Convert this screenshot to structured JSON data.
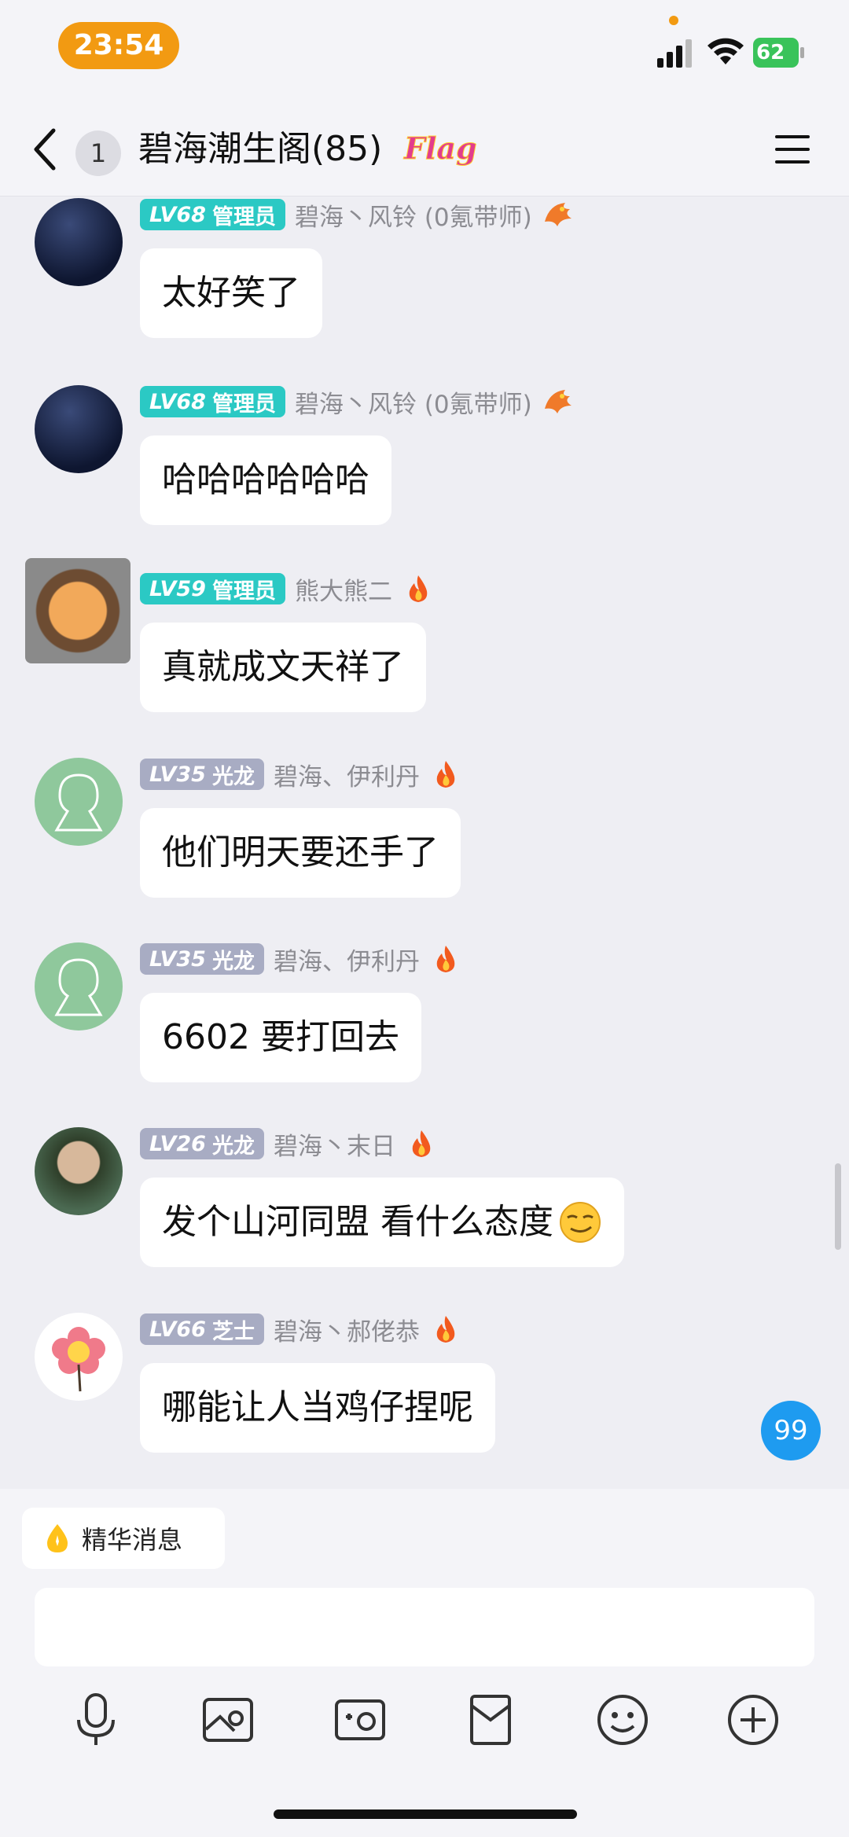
{
  "status_bar": {
    "time": "23:54",
    "battery": "62",
    "icons": [
      "cellular-icon",
      "wifi-icon",
      "battery-charging-icon"
    ]
  },
  "nav": {
    "unread_count": "1",
    "title": "碧海潮生阁(85)",
    "flag_label": "Flag",
    "icons": [
      "back-chevron-icon",
      "menu-icon"
    ]
  },
  "messages": [
    {
      "level": "LV68",
      "title": "管理员",
      "badge_color": "#2BC9C4",
      "sender": "碧海丶风铃 (0氪带师)",
      "flair_icon": "dragon-emblem-icon",
      "text": "太好笑了",
      "avatar_icon": "night-silhouette-avatar"
    },
    {
      "level": "LV68",
      "title": "管理员",
      "badge_color": "#2BC9C4",
      "sender": "碧海丶风铃 (0氪带师)",
      "flair_icon": "dragon-emblem-icon",
      "text": "哈哈哈哈哈哈",
      "avatar_icon": "night-silhouette-avatar"
    },
    {
      "level": "LV59",
      "title": "管理员",
      "badge_color": "#2BC9C4",
      "sender": "熊大熊二",
      "flair_icon": "fire-icon",
      "text": "真就成文天祥了",
      "avatar_icon": "cat-gear-frame-avatar"
    },
    {
      "level": "LV35",
      "title": "光龙",
      "badge_color": "#A8ACC3",
      "sender": "碧海、伊利丹",
      "flair_icon": "fire-icon",
      "text": "他们明天要还手了",
      "avatar_icon": "default-ghost-avatar"
    },
    {
      "level": "LV35",
      "title": "光龙",
      "badge_color": "#A8ACC3",
      "sender": "碧海、伊利丹",
      "flair_icon": "fire-icon",
      "text": "6602 要打回去",
      "avatar_icon": "default-ghost-avatar"
    },
    {
      "level": "LV26",
      "title": "光龙",
      "badge_color": "#A8ACC3",
      "sender": "碧海丶末日",
      "flair_icon": "fire-icon",
      "text": "发个山河同盟 看什么态度",
      "trailing_emoji": "smirk-emoji-icon",
      "avatar_icon": "boy-photo-avatar"
    },
    {
      "level": "LV66",
      "title": "芝士",
      "badge_color": "#A8ACC3",
      "sender": "碧海丶郝佬恭",
      "flair_icon": "fire-icon",
      "text": "哪能让人当鸡仔捏呢",
      "avatar_icon": "flower-avatar"
    }
  ],
  "new_message_count": "99",
  "essence": {
    "label": "精华消息",
    "icon": "essence-drop-icon"
  },
  "input": {
    "placeholder": ""
  },
  "toolbar": {
    "items": [
      "microphone-icon",
      "image-icon",
      "camera-icon",
      "red-packet-icon",
      "emoji-icon",
      "plus-icon"
    ]
  },
  "colors": {
    "accent_orange": "#F29A12",
    "admin_teal": "#2BC9C4",
    "level_gray": "#A8ACC3",
    "unread_blue": "#1E9BF0",
    "background": "#EEEEF3"
  }
}
